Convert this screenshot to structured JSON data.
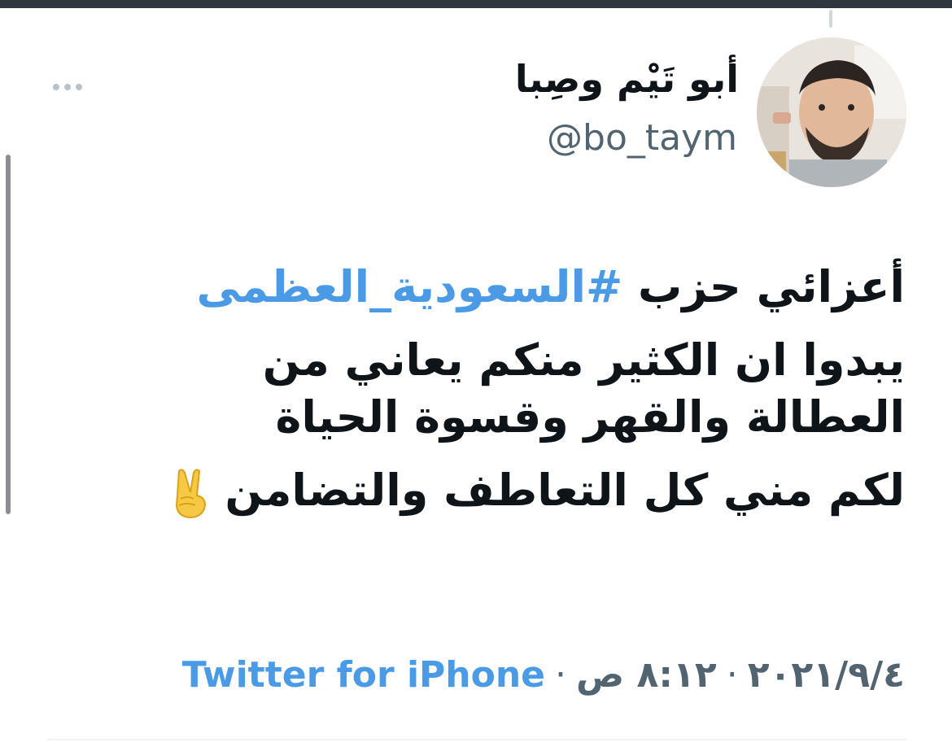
{
  "tweet": {
    "author": {
      "display_name": "أبو تَيْم وصِبا",
      "handle": "@bo_taym"
    },
    "body": {
      "intro": "أعزائي حزب ",
      "hashtag": "#السعودية_العظمى",
      "line2": "يبدوا ان الكثير منكم يعاني من العطالة والقهر وقسوة الحياة",
      "line3": "لكم مني كل التعاطف والتضامن",
      "emoji": "victory-hand"
    },
    "meta": {
      "date": "٢٠٢١/٩/٤",
      "separator": "·",
      "time": "٨:١٢ ص",
      "source": "Twitter for iPhone"
    }
  },
  "colors": {
    "link": "#4b9ae6",
    "text": "#0f1419",
    "secondary": "#536471",
    "top_bar": "#2f3640"
  },
  "icons": {
    "more": "more-horizontal-icon"
  }
}
